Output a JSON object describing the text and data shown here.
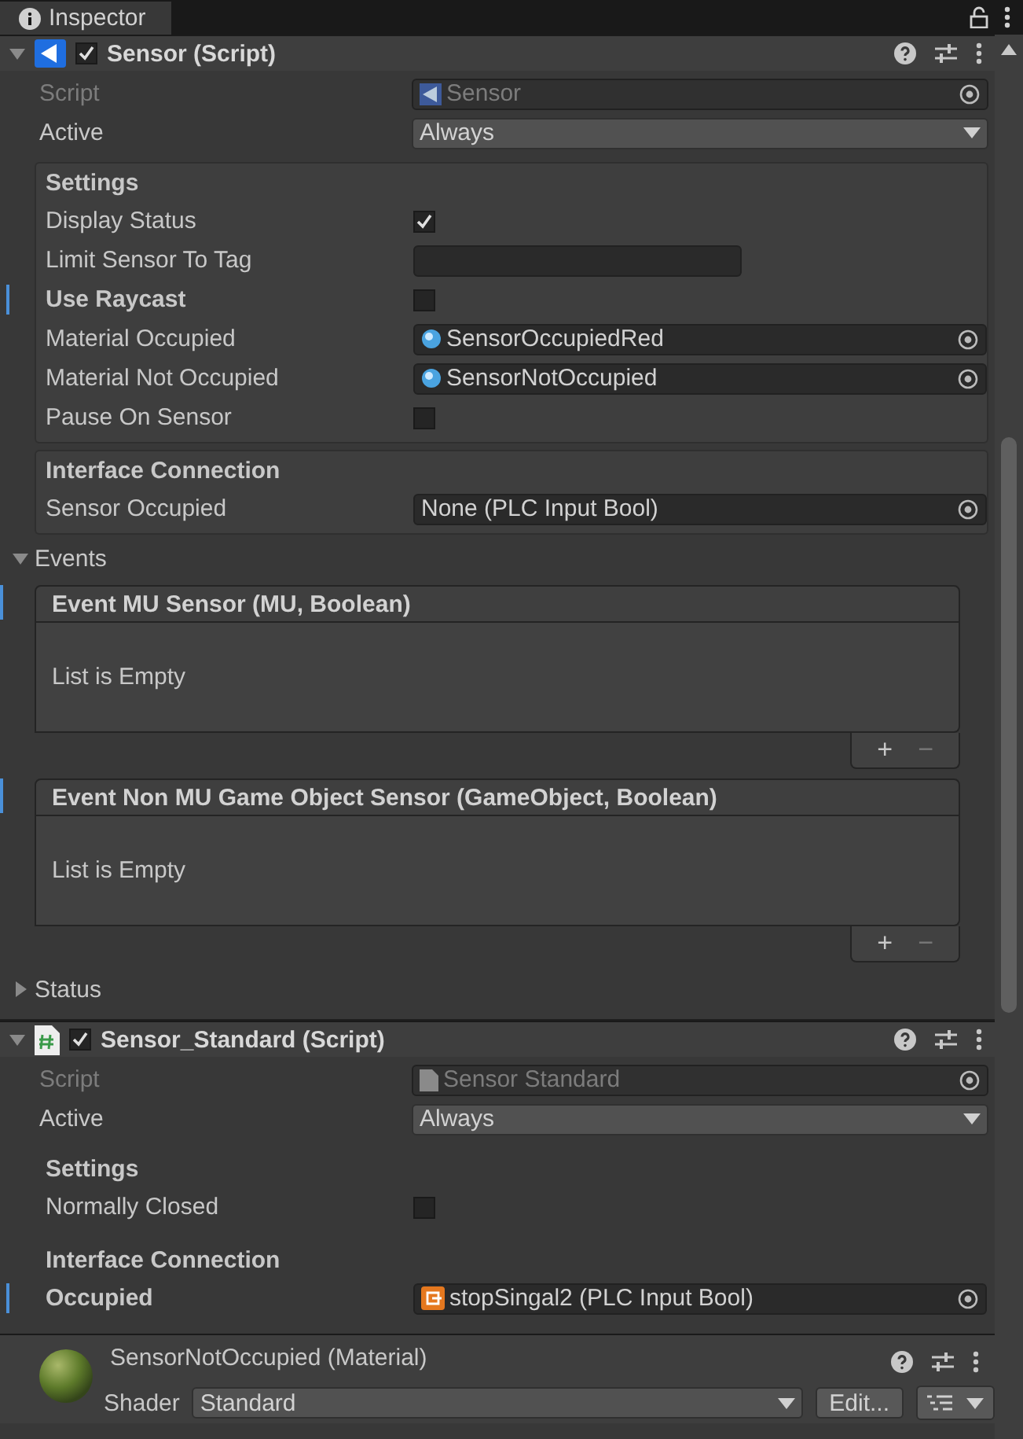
{
  "tab": {
    "title": "Inspector"
  },
  "components": [
    {
      "kind": "sensor",
      "title": "Sensor (Script)",
      "enabled": true,
      "expanded": true,
      "sections": [
        {
          "kind": "group",
          "rows": [
            {
              "kind": "sensor-ref",
              "label": "Script",
              "value": "Sensor",
              "disabled": true
            },
            {
              "kind": "dropdown",
              "label": "Active",
              "value": "Always"
            }
          ]
        },
        {
          "kind": "group",
          "boxed": true,
          "heading": "Settings",
          "rows": [
            {
              "kind": "toggle",
              "label": "Display Status",
              "checked": true,
              "modified": false
            },
            {
              "kind": "text",
              "label": "Limit Sensor To Tag",
              "modified": false
            },
            {
              "kind": "toggle",
              "label": "Use Raycast",
              "checked": false,
              "modified": true
            },
            {
              "kind": "material-ref",
              "label": "Material Occupied",
              "value": "SensorOccupiedRed",
              "disabled": false
            },
            {
              "kind": "material-ref",
              "label": "Material Not Occupied",
              "value": "SensorNotOccupied",
              "disabled": false
            },
            {
              "kind": "toggle",
              "label": "Pause On Sensor",
              "checked": false,
              "modified": false
            }
          ]
        },
        {
          "kind": "group",
          "boxed": true,
          "heading": "Interface Connection",
          "rows": [
            {
              "kind": "object",
              "label": "Sensor Occupied",
              "value": "None (PLC Input Bool)",
              "disabled": false
            }
          ]
        },
        {
          "kind": "foldout",
          "title": "Events",
          "expanded": true,
          "events": [
            {
              "title": "Event MU Sensor (MU, Boolean)",
              "empty": "List is Empty",
              "modified": true,
              "add": "+",
              "remove": "−"
            },
            {
              "title": "Event Non MU Game Object Sensor (GameObject, Boolean)",
              "empty": "List is Empty",
              "modified": true,
              "add": "+",
              "remove": "−"
            }
          ]
        },
        {
          "kind": "foldout",
          "title": "Status",
          "expanded": false
        }
      ]
    },
    {
      "kind": "csharp",
      "title": "Sensor_Standard (Script)",
      "enabled": true,
      "expanded": true,
      "sections": [
        {
          "kind": "group",
          "rows": [
            {
              "kind": "csharp-ref",
              "label": "Script",
              "value": "Sensor Standard",
              "disabled": true
            },
            {
              "kind": "dropdown",
              "label": "Active",
              "value": "Always"
            }
          ]
        },
        {
          "kind": "group",
          "boxed": false,
          "heading": "Settings",
          "rows": [
            {
              "kind": "toggle",
              "label": "Normally Closed",
              "checked": false,
              "modified": false
            }
          ]
        },
        {
          "kind": "group",
          "boxed": false,
          "heading": "Interface Connection",
          "rows": [
            {
              "kind": "plc-ref",
              "label": "Occupied",
              "value": "stopSingal2 (PLC Input Bool)",
              "disabled": false,
              "modified": true
            }
          ]
        }
      ]
    }
  ],
  "material": {
    "title": "SensorNotOccupied (Material)",
    "shader_label": "Shader",
    "shader": "Standard",
    "edit": "Edit..."
  }
}
